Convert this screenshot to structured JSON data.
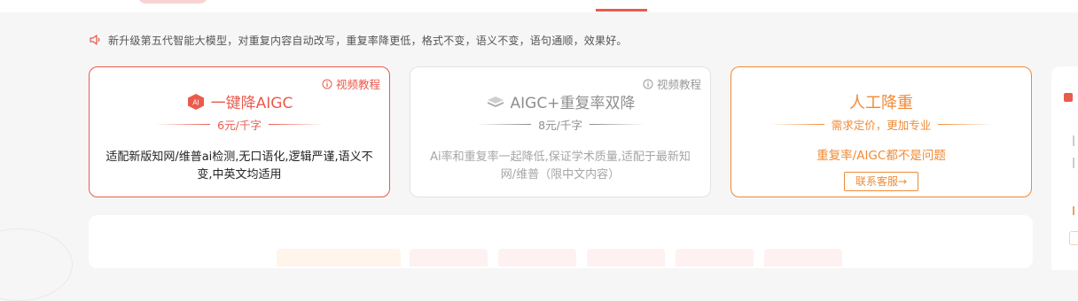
{
  "notice": {
    "icon": "speaker-icon",
    "text": "新升级第五代智能大模型，对重复内容自动改写，重复率降更低，格式不变，语义不变，语句通顺，效果好。"
  },
  "cards": [
    {
      "tutorial_label": "视频教程",
      "badge_text": "AI",
      "title": "一键降AIGC",
      "price": "6元/千字",
      "description": "适配新版知网/维普ai检测,无口语化,逻辑严谨,语义不变,中英文均适用",
      "accent_color": "#ea5b4d"
    },
    {
      "tutorial_label": "视频教程",
      "title": "AIGC+重复率双降",
      "price": "8元/千字",
      "description": "Ai率和重复率一起降低,保证学术质量,适配于最新知网/维普（限中文内容）",
      "accent_color": "#8f8f8f"
    },
    {
      "title": "人工降重",
      "price": "需求定价，更加专业",
      "description": "重复率/AIGC都不是问题",
      "button_label": "联系客服→",
      "accent_color": "#f08a35"
    }
  ]
}
